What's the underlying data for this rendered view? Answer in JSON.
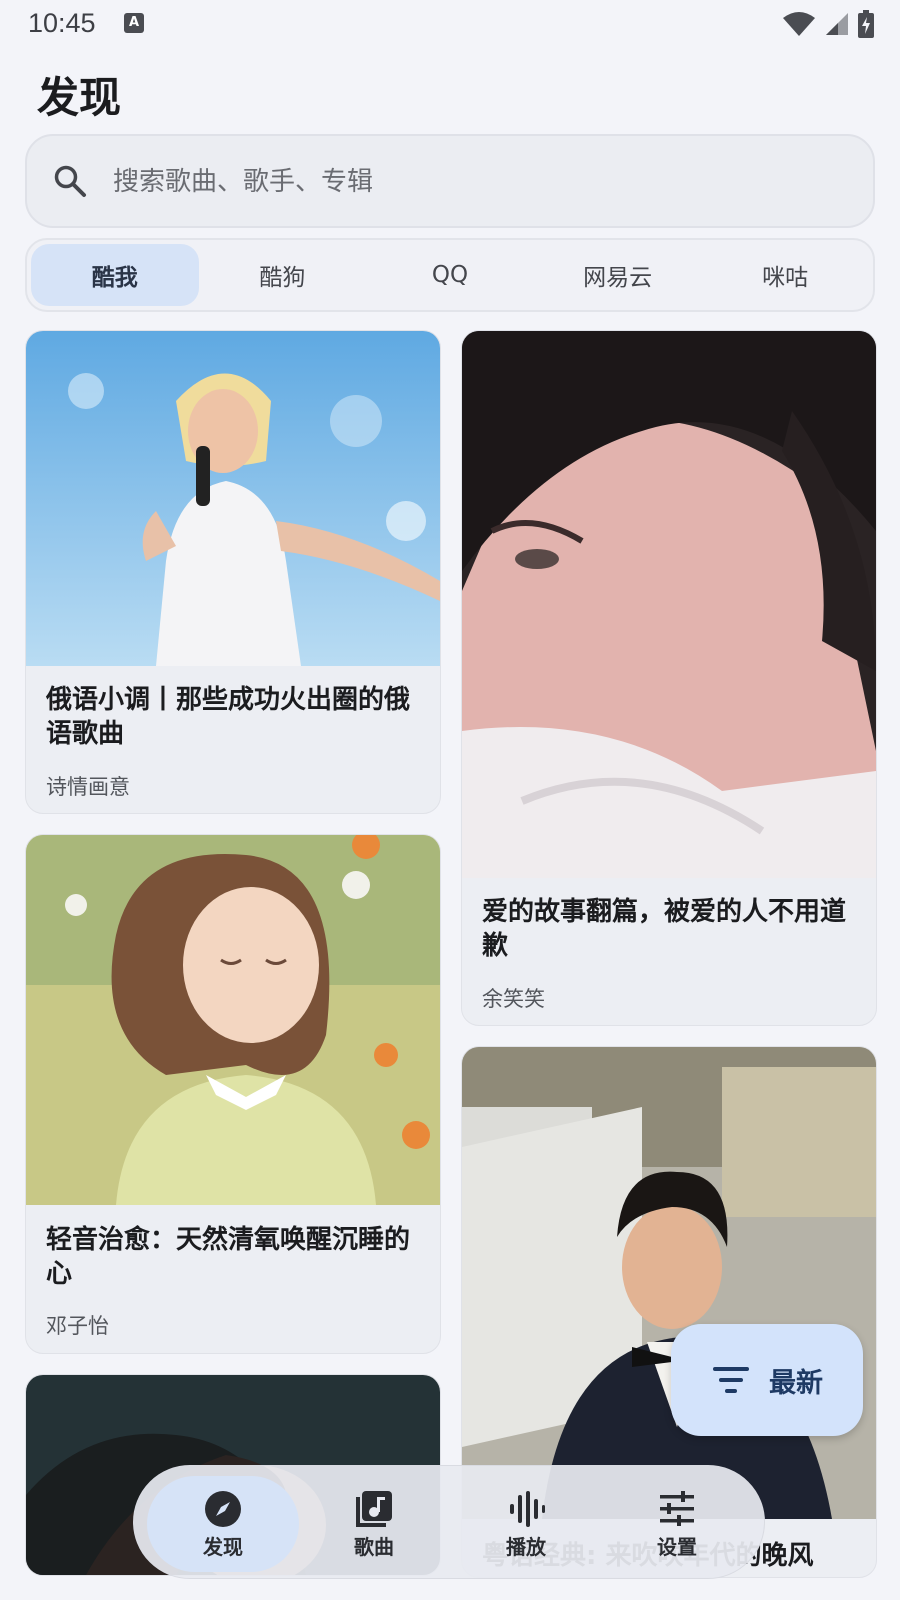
{
  "status_bar": {
    "time": "10:45",
    "notification_badge": "A"
  },
  "page": {
    "title": "发现"
  },
  "search": {
    "placeholder": "搜索歌曲、歌手、专辑"
  },
  "sources": {
    "tabs": [
      {
        "label": "酷我",
        "active": true
      },
      {
        "label": "酷狗",
        "active": false
      },
      {
        "label": "QQ",
        "active": false
      },
      {
        "label": "网易云",
        "active": false
      },
      {
        "label": "咪咕",
        "active": false
      }
    ]
  },
  "playlists": [
    {
      "title": "俄语小调丨那些成功火出圈的俄语歌曲",
      "creator": "诗情画意",
      "image": "singer-on-stage-photo"
    },
    {
      "title": "爱的故事翻篇，被爱的人不用道歉",
      "creator": "余笑笑",
      "image": "crying-girl-photo"
    },
    {
      "title": "轻音治愈：天然清氧唤醒沉睡的心",
      "creator": "邓子怡",
      "image": "illustrated-girl-in-flowers"
    },
    {
      "title": "粤语经典: 来吹吹年代的晚风",
      "creator": "",
      "image": "man-in-tuxedo-photo"
    },
    {
      "title": "",
      "creator": "",
      "image": "dark-portrait-photo"
    }
  ],
  "fab": {
    "label": "最新",
    "icon": "sort-icon"
  },
  "bottom_nav": {
    "items": [
      {
        "label": "发现",
        "icon": "compass-icon",
        "active": true
      },
      {
        "label": "歌曲",
        "icon": "music-library-icon",
        "active": false
      },
      {
        "label": "播放",
        "icon": "waveform-icon",
        "active": false
      },
      {
        "label": "设置",
        "icon": "sliders-icon",
        "active": false
      }
    ]
  },
  "colors": {
    "accent_container": "#d6e3f7",
    "background": "#f3f4f9",
    "fab": "#d3e3fb"
  }
}
